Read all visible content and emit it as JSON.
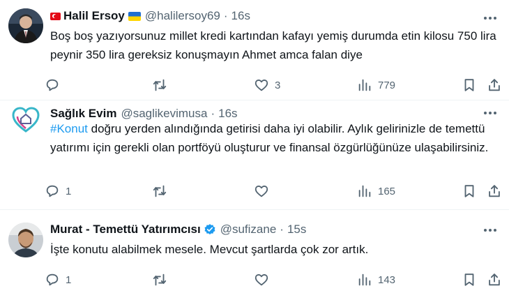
{
  "tweets": [
    {
      "name": "Halil Ersoy",
      "handle": "@halilersoy69",
      "time": "16s",
      "text": "Boş boş yazıyorsunuz millet kredi kartından kafayı yemiş durumda etin kilosu 750 lira peynir 350 lira gereksiz konuşmayın Ahmet amca falan diye",
      "likes": "3",
      "views": "779",
      "flags": [
        "turkey-flag",
        "ukraine-flag"
      ]
    },
    {
      "name": "Sağlık Evim",
      "handle": "@saglikevimusa",
      "time": "16s",
      "hashtag": "#Konut",
      "text": "doğru yerden alındığında getirisi daha iyi olabilir. Aylık gelirinizle de temettü yatırımı için gerekli olan portföyü oluşturur ve finansal özgürlüğünüze ulaşabilirsiniz.",
      "replies": "1",
      "views": "165"
    },
    {
      "name": "Murat - Temettü Yatırımcısı",
      "handle": "@sufizane",
      "time": "15s",
      "text": "İşte konutu alabilmek mesele. Mevcut şartlarda çok zor artık.",
      "replies": "1",
      "views": "143",
      "verified": true
    }
  ],
  "separator": "·",
  "colors": {
    "link": "#1d9bf0",
    "muted": "#536471",
    "text": "#0f1419",
    "verified": "#1d9bf0"
  }
}
